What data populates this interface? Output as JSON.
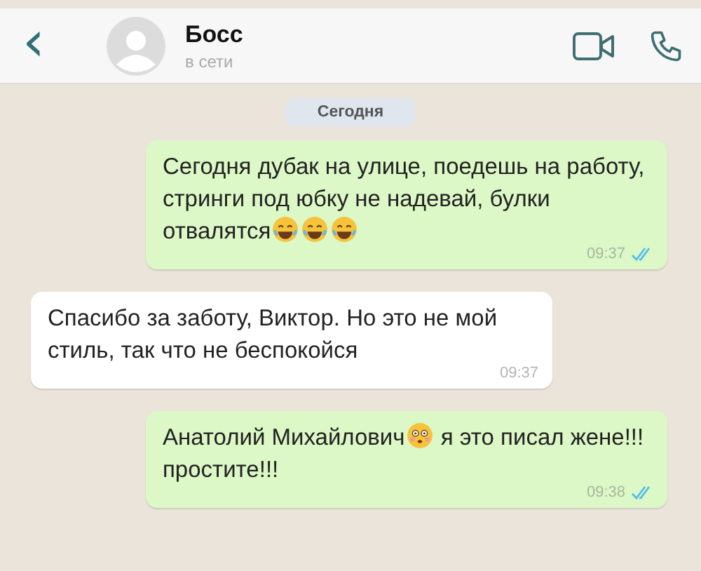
{
  "header": {
    "back": "‹",
    "contact": {
      "name": "Босс",
      "status": "в сети"
    }
  },
  "date_divider": "Сегодня",
  "messages": [
    {
      "kind": "outgoing",
      "parts": [
        {
          "kind": "text",
          "text": "Сегодня дубак на улице, поедешь на работу, стринги под юбку не надевай, булки отвалятся"
        },
        {
          "kind": "laugh"
        },
        {
          "kind": "laugh"
        },
        {
          "kind": "laugh"
        }
      ],
      "time": "09:37",
      "read": true
    },
    {
      "kind": "incoming",
      "parts": [
        {
          "kind": "text",
          "text": "Спасибо за заботу, Виктор. Но это не мой стиль, так что не беспокойся"
        }
      ],
      "time": "09:37",
      "read": false
    },
    {
      "kind": "outgoing",
      "parts": [
        {
          "kind": "text",
          "text": "Анатолий Михайлович"
        },
        {
          "kind": "flushed"
        },
        {
          "kind": "text",
          "text": " я это писал жене!!! простите!!!"
        }
      ],
      "time": "09:38",
      "read": true
    }
  ]
}
